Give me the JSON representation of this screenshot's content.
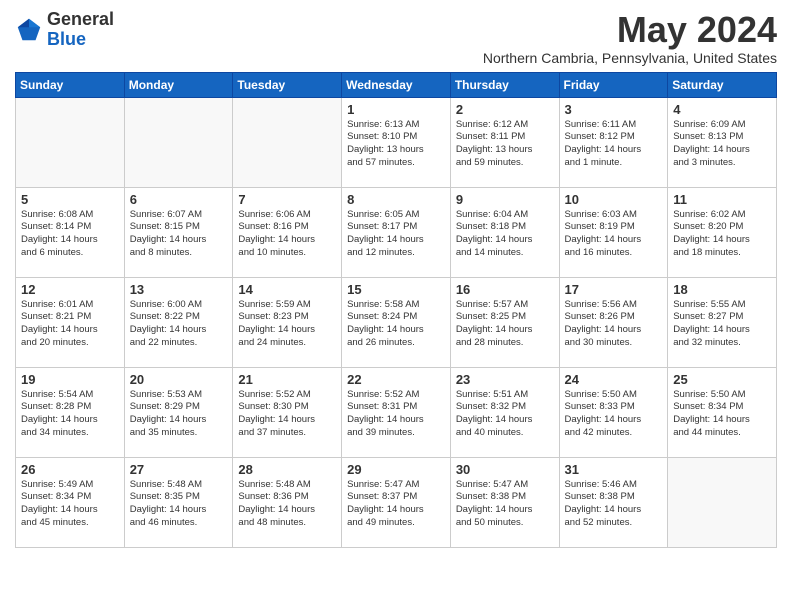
{
  "header": {
    "logo_general": "General",
    "logo_blue": "Blue",
    "month_title": "May 2024",
    "location": "Northern Cambria, Pennsylvania, United States"
  },
  "weekdays": [
    "Sunday",
    "Monday",
    "Tuesday",
    "Wednesday",
    "Thursday",
    "Friday",
    "Saturday"
  ],
  "weeks": [
    [
      {
        "day": "",
        "text": ""
      },
      {
        "day": "",
        "text": ""
      },
      {
        "day": "",
        "text": ""
      },
      {
        "day": "1",
        "text": "Sunrise: 6:13 AM\nSunset: 8:10 PM\nDaylight: 13 hours\nand 57 minutes."
      },
      {
        "day": "2",
        "text": "Sunrise: 6:12 AM\nSunset: 8:11 PM\nDaylight: 13 hours\nand 59 minutes."
      },
      {
        "day": "3",
        "text": "Sunrise: 6:11 AM\nSunset: 8:12 PM\nDaylight: 14 hours\nand 1 minute."
      },
      {
        "day": "4",
        "text": "Sunrise: 6:09 AM\nSunset: 8:13 PM\nDaylight: 14 hours\nand 3 minutes."
      }
    ],
    [
      {
        "day": "5",
        "text": "Sunrise: 6:08 AM\nSunset: 8:14 PM\nDaylight: 14 hours\nand 6 minutes."
      },
      {
        "day": "6",
        "text": "Sunrise: 6:07 AM\nSunset: 8:15 PM\nDaylight: 14 hours\nand 8 minutes."
      },
      {
        "day": "7",
        "text": "Sunrise: 6:06 AM\nSunset: 8:16 PM\nDaylight: 14 hours\nand 10 minutes."
      },
      {
        "day": "8",
        "text": "Sunrise: 6:05 AM\nSunset: 8:17 PM\nDaylight: 14 hours\nand 12 minutes."
      },
      {
        "day": "9",
        "text": "Sunrise: 6:04 AM\nSunset: 8:18 PM\nDaylight: 14 hours\nand 14 minutes."
      },
      {
        "day": "10",
        "text": "Sunrise: 6:03 AM\nSunset: 8:19 PM\nDaylight: 14 hours\nand 16 minutes."
      },
      {
        "day": "11",
        "text": "Sunrise: 6:02 AM\nSunset: 8:20 PM\nDaylight: 14 hours\nand 18 minutes."
      }
    ],
    [
      {
        "day": "12",
        "text": "Sunrise: 6:01 AM\nSunset: 8:21 PM\nDaylight: 14 hours\nand 20 minutes."
      },
      {
        "day": "13",
        "text": "Sunrise: 6:00 AM\nSunset: 8:22 PM\nDaylight: 14 hours\nand 22 minutes."
      },
      {
        "day": "14",
        "text": "Sunrise: 5:59 AM\nSunset: 8:23 PM\nDaylight: 14 hours\nand 24 minutes."
      },
      {
        "day": "15",
        "text": "Sunrise: 5:58 AM\nSunset: 8:24 PM\nDaylight: 14 hours\nand 26 minutes."
      },
      {
        "day": "16",
        "text": "Sunrise: 5:57 AM\nSunset: 8:25 PM\nDaylight: 14 hours\nand 28 minutes."
      },
      {
        "day": "17",
        "text": "Sunrise: 5:56 AM\nSunset: 8:26 PM\nDaylight: 14 hours\nand 30 minutes."
      },
      {
        "day": "18",
        "text": "Sunrise: 5:55 AM\nSunset: 8:27 PM\nDaylight: 14 hours\nand 32 minutes."
      }
    ],
    [
      {
        "day": "19",
        "text": "Sunrise: 5:54 AM\nSunset: 8:28 PM\nDaylight: 14 hours\nand 34 minutes."
      },
      {
        "day": "20",
        "text": "Sunrise: 5:53 AM\nSunset: 8:29 PM\nDaylight: 14 hours\nand 35 minutes."
      },
      {
        "day": "21",
        "text": "Sunrise: 5:52 AM\nSunset: 8:30 PM\nDaylight: 14 hours\nand 37 minutes."
      },
      {
        "day": "22",
        "text": "Sunrise: 5:52 AM\nSunset: 8:31 PM\nDaylight: 14 hours\nand 39 minutes."
      },
      {
        "day": "23",
        "text": "Sunrise: 5:51 AM\nSunset: 8:32 PM\nDaylight: 14 hours\nand 40 minutes."
      },
      {
        "day": "24",
        "text": "Sunrise: 5:50 AM\nSunset: 8:33 PM\nDaylight: 14 hours\nand 42 minutes."
      },
      {
        "day": "25",
        "text": "Sunrise: 5:50 AM\nSunset: 8:34 PM\nDaylight: 14 hours\nand 44 minutes."
      }
    ],
    [
      {
        "day": "26",
        "text": "Sunrise: 5:49 AM\nSunset: 8:34 PM\nDaylight: 14 hours\nand 45 minutes."
      },
      {
        "day": "27",
        "text": "Sunrise: 5:48 AM\nSunset: 8:35 PM\nDaylight: 14 hours\nand 46 minutes."
      },
      {
        "day": "28",
        "text": "Sunrise: 5:48 AM\nSunset: 8:36 PM\nDaylight: 14 hours\nand 48 minutes."
      },
      {
        "day": "29",
        "text": "Sunrise: 5:47 AM\nSunset: 8:37 PM\nDaylight: 14 hours\nand 49 minutes."
      },
      {
        "day": "30",
        "text": "Sunrise: 5:47 AM\nSunset: 8:38 PM\nDaylight: 14 hours\nand 50 minutes."
      },
      {
        "day": "31",
        "text": "Sunrise: 5:46 AM\nSunset: 8:38 PM\nDaylight: 14 hours\nand 52 minutes."
      },
      {
        "day": "",
        "text": ""
      }
    ]
  ]
}
